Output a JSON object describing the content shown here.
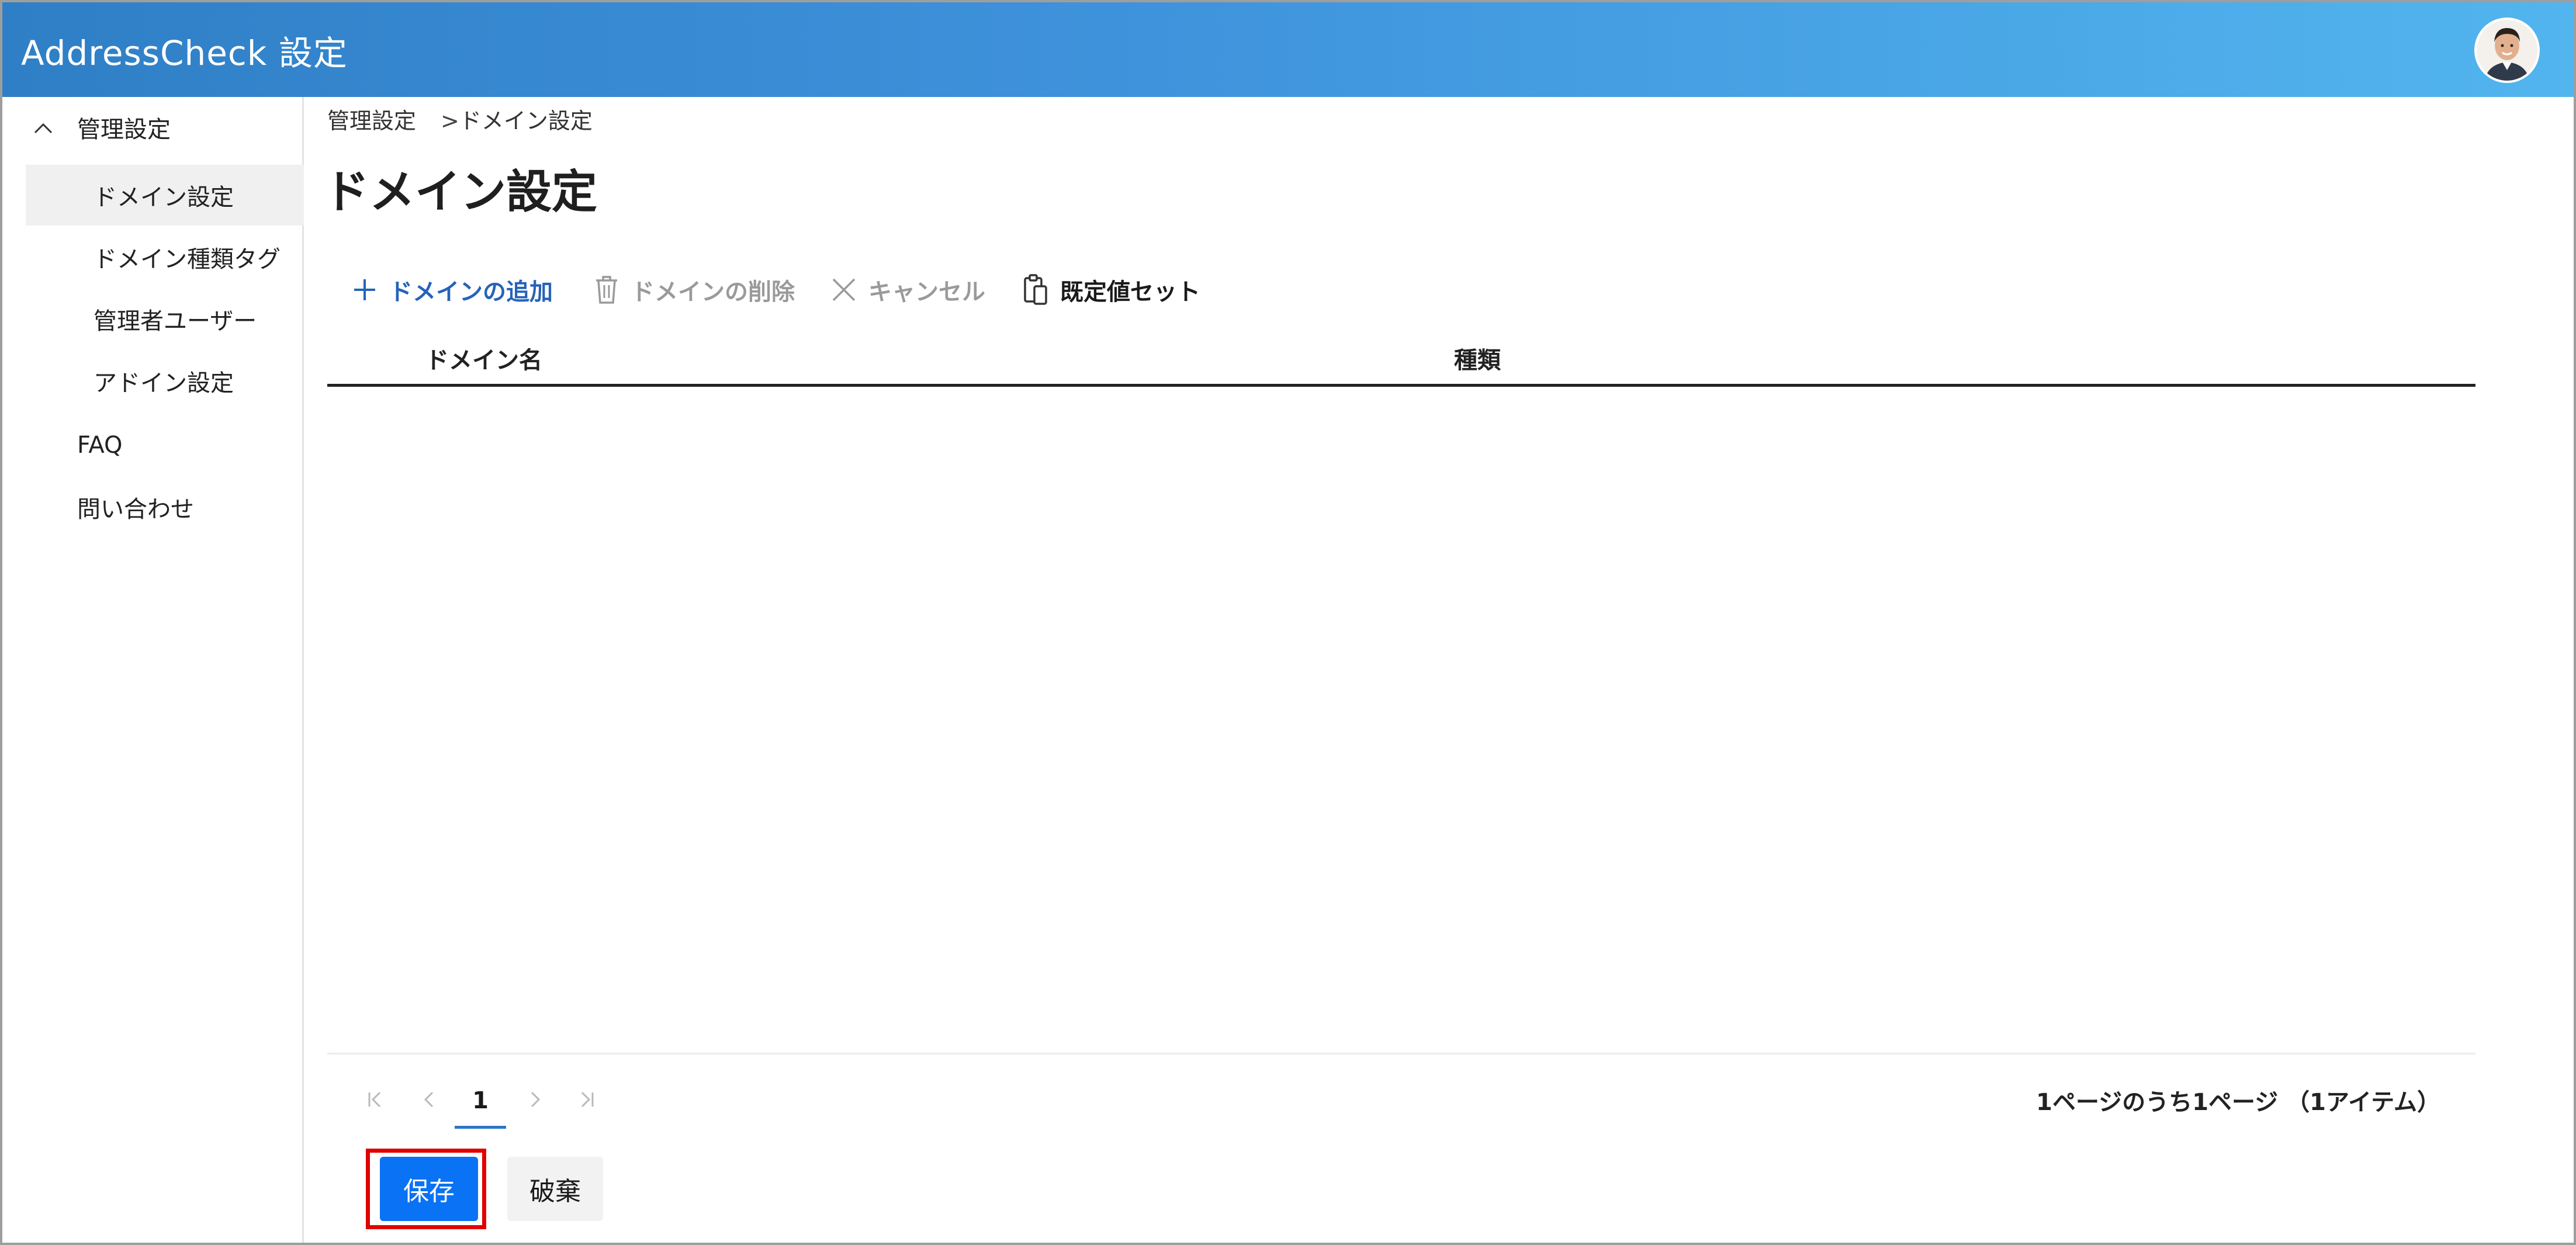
{
  "header": {
    "app_title": "AddressCheck 設定",
    "avatar_icon": "user-avatar",
    "gradient_start": "#2f7fc6",
    "gradient_end": "#52b5ee"
  },
  "sidebar": {
    "group_label": "管理設定",
    "group_expanded": true,
    "items": [
      {
        "label": "ドメイン設定",
        "selected": true
      },
      {
        "label": "ドメイン種類タグ",
        "selected": false
      },
      {
        "label": "管理者ユーザー",
        "selected": false
      },
      {
        "label": "アドイン設定",
        "selected": false
      }
    ],
    "faq_label": "FAQ",
    "contact_label": "問い合わせ"
  },
  "breadcrumb": {
    "parent": "管理設定",
    "separator": ">",
    "current": "ドメイン設定"
  },
  "page": {
    "title": "ドメイン設定"
  },
  "toolbar": {
    "add_label": "ドメインの追加",
    "delete_label": "ドメインの削除",
    "cancel_label": "キャンセル",
    "default_label": "既定値セット",
    "accent_color": "#2563b8"
  },
  "grid": {
    "columns": [
      "ドメイン名",
      "種類"
    ],
    "rows": []
  },
  "pager": {
    "current_page": "1",
    "summary": "1ページのうち1ページ （1アイテム）"
  },
  "actions": {
    "save_label": "保存",
    "discard_label": "破棄",
    "save_color": "#0a72f5",
    "highlight_color": "#e00000"
  }
}
